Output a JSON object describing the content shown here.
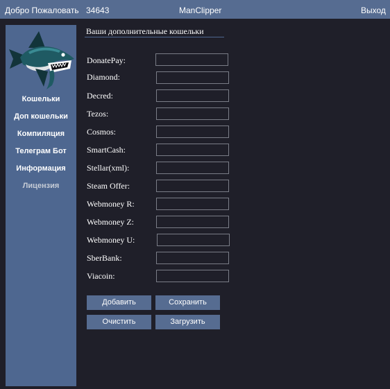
{
  "header": {
    "welcome_label": "Добро Пожаловать",
    "user_id": "34643",
    "app_title": "ManClipper",
    "exit_label": "Выход"
  },
  "sidebar": {
    "logo_icon": "shark-mascot-icon",
    "items": [
      {
        "label": "Кошельки"
      },
      {
        "label": "Доп кошельки"
      },
      {
        "label": "Компиляция"
      },
      {
        "label": "Телеграм Бот"
      },
      {
        "label": "Информация"
      },
      {
        "label": "Лицензия"
      }
    ]
  },
  "main": {
    "title": "Ваши дополнительные кошельки",
    "wallets": [
      {
        "label": "DonatePay:",
        "value": ""
      },
      {
        "label": "Diamond:",
        "value": ""
      },
      {
        "label": "Decred:",
        "value": ""
      },
      {
        "label": "Tezos:",
        "value": ""
      },
      {
        "label": "Cosmos:",
        "value": ""
      },
      {
        "label": "SmartCash:",
        "value": ""
      },
      {
        "label": "Stellar(xml):",
        "value": ""
      },
      {
        "label": "Steam Offer:",
        "value": ""
      },
      {
        "label": "Webmoney R:",
        "value": ""
      },
      {
        "label": "Webmoney Z:",
        "value": ""
      },
      {
        "label": "Webmoney U:",
        "value": ""
      },
      {
        "label": "SberBank:",
        "value": ""
      },
      {
        "label": "Viacoin:",
        "value": ""
      }
    ],
    "buttons": {
      "add": "Добавить",
      "save": "Сохранить",
      "clear": "Очистить",
      "load": "Загрузить"
    }
  },
  "colors": {
    "background": "#1f1f29",
    "header": "#566c91",
    "sidebar": "#4e6790",
    "text": "#ffffff",
    "field_border": "#7a7d87"
  }
}
